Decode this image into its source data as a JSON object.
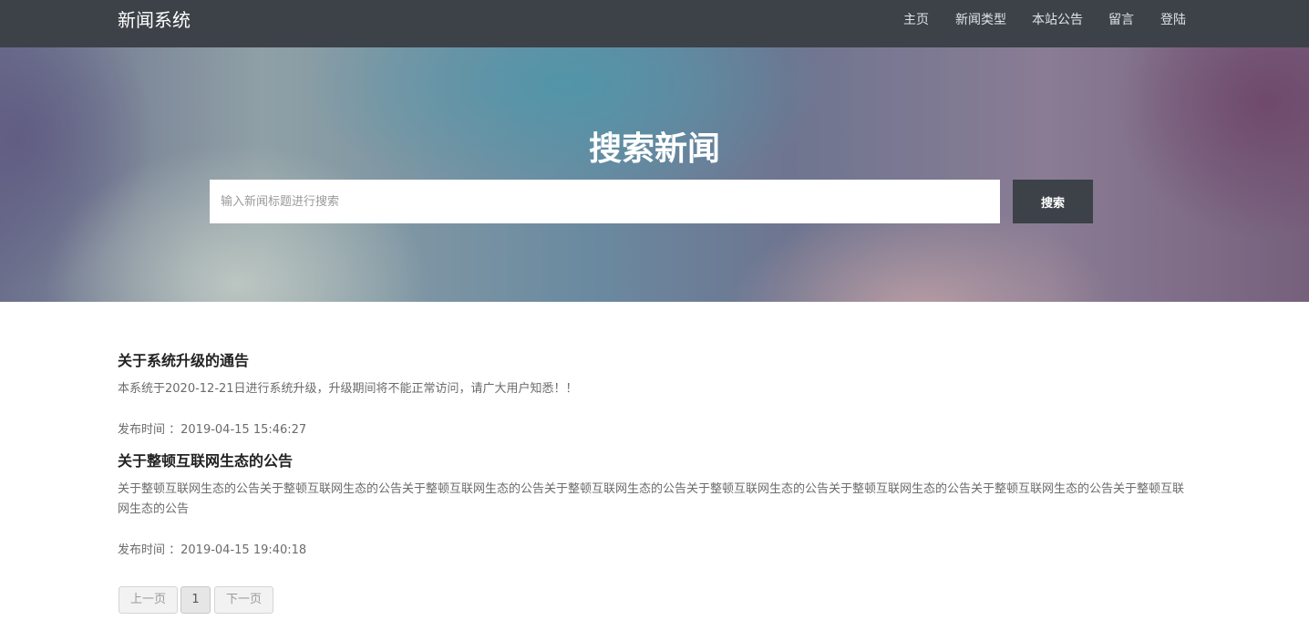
{
  "navbar": {
    "brand": "新闻系统",
    "links": [
      "主页",
      "新闻类型",
      "本站公告",
      "留言",
      "登陆"
    ]
  },
  "hero": {
    "title": "搜索新闻",
    "search_placeholder": "输入新闻标题进行搜索",
    "search_button": "搜索"
  },
  "articles": [
    {
      "title": "关于系统升级的通告",
      "summary": "本系统于2020-12-21日进行系统升级，升级期间将不能正常访问，请广大用户知悉！！",
      "meta": "发布时间 ：2019-04-15 15:46:27"
    },
    {
      "title": "关于整顿互联网生态的公告",
      "summary": "关于整顿互联网生态的公告关于整顿互联网生态的公告关于整顿互联网生态的公告关于整顿互联网生态的公告关于整顿互联网生态的公告关于整顿互联网生态的公告关于整顿互联网生态的公告关于整顿互联网生态的公告",
      "meta": "发布时间 ：2019-04-15 19:40:18"
    }
  ],
  "pagination": {
    "prev": "上一页",
    "current": "1",
    "next": "下一页"
  },
  "colors": {
    "navbar_bg": "#3c4248",
    "button_bg": "#3c4248"
  }
}
